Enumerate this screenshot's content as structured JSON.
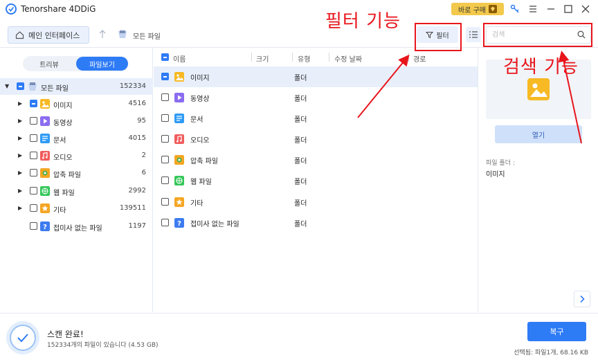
{
  "app": {
    "title": "Tenorshare 4DDiG",
    "buy_label": "바로 구매"
  },
  "toolbar": {
    "home_label": "메인 인터페이스",
    "breadcrumb": "모든 파일",
    "filter_label": "필터",
    "search_placeholder": "검색"
  },
  "annotations": {
    "filter": "필터 기능",
    "search": "검색 기능"
  },
  "left": {
    "tab_tree": "트리뷰",
    "tab_file": "파일보기",
    "root": {
      "label": "모든 파일",
      "count": "152334"
    },
    "items": [
      {
        "label": "이미지",
        "count": "4516",
        "icon": "image-icon",
        "color": "#f7b924"
      },
      {
        "label": "동영상",
        "count": "95",
        "icon": "video-icon",
        "color": "#8b6cf0"
      },
      {
        "label": "문서",
        "count": "4015",
        "icon": "document-icon",
        "color": "#2e9bf6"
      },
      {
        "label": "오디오",
        "count": "2",
        "icon": "audio-icon",
        "color": "#f25c5c"
      },
      {
        "label": "압축 파일",
        "count": "6",
        "icon": "archive-icon",
        "color": "#f5a623"
      },
      {
        "label": "웹 파일",
        "count": "2992",
        "icon": "web-icon",
        "color": "#34c759"
      },
      {
        "label": "기타",
        "count": "139511",
        "icon": "other-icon",
        "color": "#f5a623"
      },
      {
        "label": "접미사 없는 파일",
        "count": "1197",
        "icon": "unknown-icon",
        "color": "#3d7cf0"
      }
    ]
  },
  "table": {
    "columns": [
      "이름",
      "크기",
      "유형",
      "수정 날짜",
      "경로"
    ],
    "rows": [
      {
        "name": "이미지",
        "type": "폴더"
      },
      {
        "name": "동영상",
        "type": "폴더"
      },
      {
        "name": "문서",
        "type": "폴더"
      },
      {
        "name": "오디오",
        "type": "폴더"
      },
      {
        "name": "압축 파일",
        "type": "폴더"
      },
      {
        "name": "웹 파일",
        "type": "폴더"
      },
      {
        "name": "기타",
        "type": "폴더"
      },
      {
        "name": "접미사 없는 파일",
        "type": "폴더"
      }
    ]
  },
  "right": {
    "open_label": "열기",
    "path_label": "파일 폴더 :",
    "path_value": "이미지"
  },
  "bottom": {
    "scan_title": "스캔 완료!",
    "scan_sub": "152334개의 파일이 있습니다 (4.53 GB)",
    "recover_label": "복구",
    "selected_info": "선택됨: 파일1개, 68.16 KB"
  },
  "colors": {
    "accent": "#2e7bf6",
    "annotation": "#e8151b"
  }
}
